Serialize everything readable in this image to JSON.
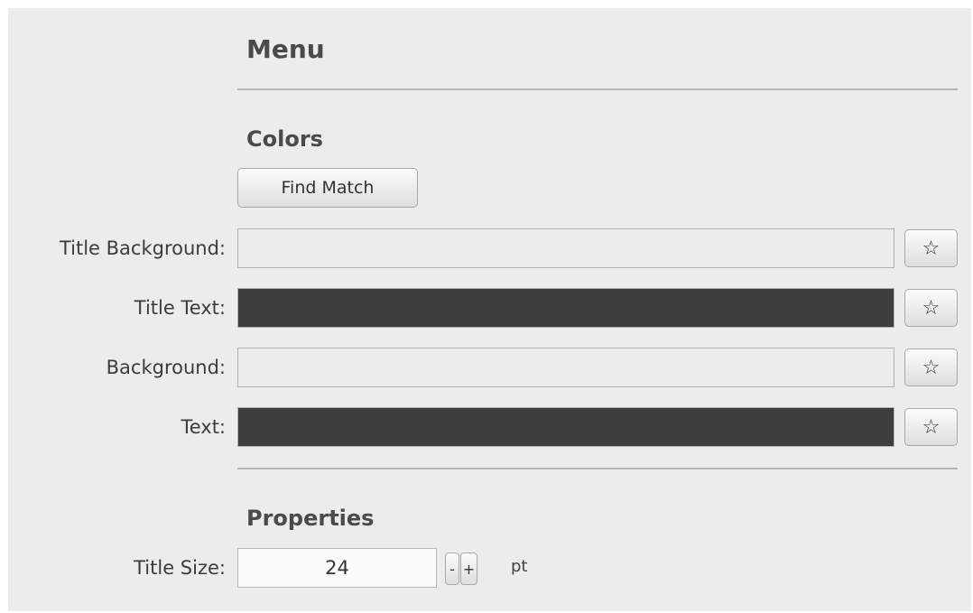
{
  "sections": {
    "menu_title": "Menu",
    "colors_title": "Colors",
    "properties_title": "Properties"
  },
  "colors": {
    "find_match_label": "Find Match",
    "rows": [
      {
        "label": "Title Background:",
        "swatch": "#ececec"
      },
      {
        "label": "Title Text:",
        "swatch": "#3d3d3d"
      },
      {
        "label": "Background:",
        "swatch": "#ececec"
      },
      {
        "label": "Text:",
        "swatch": "#3d3d3d"
      }
    ],
    "star_glyph": "☆"
  },
  "properties": {
    "title_size_label": "Title Size:",
    "title_size_value": "24",
    "decrement_label": "-",
    "increment_label": "+",
    "unit": "pt"
  }
}
